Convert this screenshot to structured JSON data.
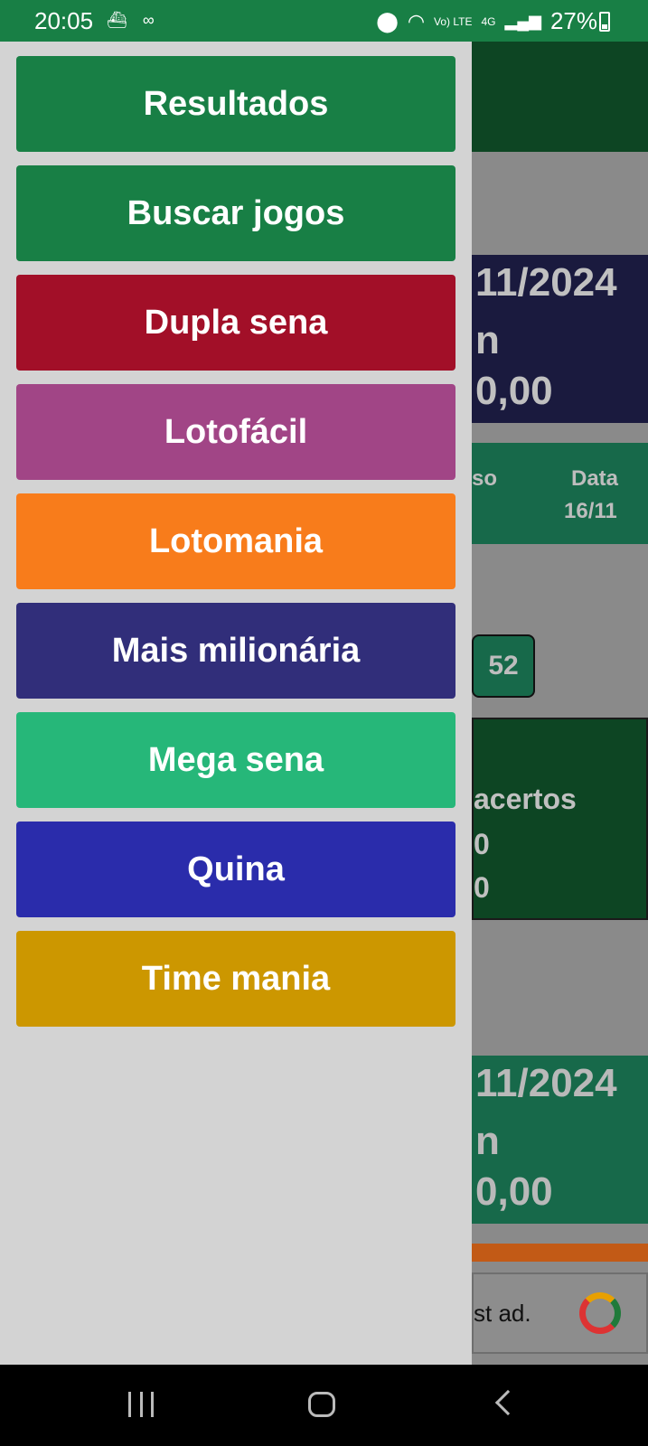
{
  "status_bar": {
    "time": "20:05",
    "left_icons": [
      "ship-icon",
      "voicemail-icon"
    ],
    "right_icons": [
      "location-icon",
      "wifi-icon",
      "volte-icon",
      "4g-icon",
      "signal-icon"
    ],
    "volte_label": "Vo) LTE",
    "network_label": "4G",
    "battery_percent": "27%"
  },
  "drawer": {
    "items": [
      {
        "label": "Resultados",
        "color": "#187f45"
      },
      {
        "label": "Buscar jogos",
        "color": "#187f45"
      },
      {
        "label": "Dupla sena",
        "color": "#a20f28"
      },
      {
        "label": "Lotofácil",
        "color": "#a14586"
      },
      {
        "label": "Lotomania",
        "color": "#f87c1b"
      },
      {
        "label": "Mais milionária",
        "color": "#312e7a"
      },
      {
        "label": "Mega sena",
        "color": "#26b779"
      },
      {
        "label": "Quina",
        "color": "#2a2cab"
      },
      {
        "label": "Time mania",
        "color": "#cc9700"
      }
    ]
  },
  "background": {
    "card1_line1": "11/2024",
    "card1_line2": "n",
    "card1_line3": "0,00",
    "card2_left": "so",
    "card2_header": "Data",
    "card2_value": "16/11",
    "ball_number": "52",
    "card3_line1": "acertos",
    "card3_line2": "0",
    "card3_line3": "0",
    "card4_line1": "11/2024",
    "card4_line2": "n",
    "card4_line3": "0,00",
    "ad_text": "st ad."
  },
  "nav_bar": {
    "buttons": [
      "recents-icon",
      "home-icon",
      "back-icon"
    ]
  }
}
